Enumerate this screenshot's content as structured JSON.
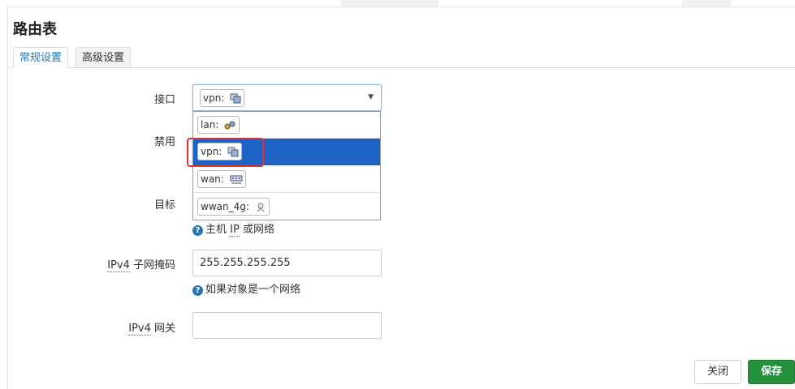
{
  "page": {
    "title": "路由表"
  },
  "tabs": [
    {
      "label": "常规设置",
      "active": true
    },
    {
      "label": "高级设置",
      "active": false
    }
  ],
  "form": {
    "interface": {
      "label": "接口",
      "selected": {
        "name": "vpn:",
        "icon": "vpn-network-icon"
      },
      "options": [
        {
          "name": "lan:",
          "icon": "lan-network-icon"
        },
        {
          "name": "vpn:",
          "icon": "vpn-network-icon",
          "selected": true
        },
        {
          "name": "wan:",
          "icon": "wan-network-icon"
        },
        {
          "name": "wwan_4g:",
          "icon": "wwan-network-icon"
        }
      ]
    },
    "disable": {
      "label": "禁用"
    },
    "target": {
      "label": "目标",
      "help_prefix": "主机 ",
      "help_abbr": "IP",
      "help_suffix": " 或网络"
    },
    "netmask": {
      "label_abbr": "IPv4",
      "label_rest": " 子网掩码",
      "value": "255.255.255.255",
      "help": "如果对象是一个网络"
    },
    "gateway": {
      "label_abbr": "IPv4",
      "label_rest": " 网关",
      "value": ""
    }
  },
  "buttons": {
    "close": "关闭",
    "save": "保存"
  },
  "colors": {
    "accent": "#2478b5",
    "save": "#24913c",
    "dropdown_selected": "#1e62c4",
    "highlight": "#e03030"
  }
}
